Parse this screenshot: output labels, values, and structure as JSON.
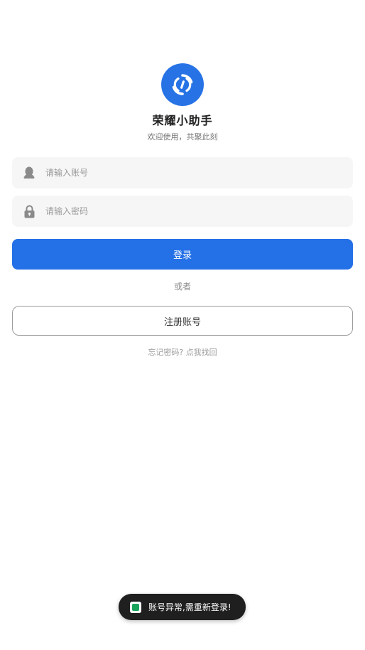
{
  "app": {
    "title": "荣耀小助手",
    "subtitle": "欢迎使用，共聚此刻",
    "logo_icon": "sync-circle-icon",
    "accent_color": "#2470e6"
  },
  "form": {
    "account": {
      "placeholder": "请输入账号",
      "value": "",
      "icon": "user-icon"
    },
    "password": {
      "placeholder": "请输入密码",
      "value": "",
      "icon": "lock-icon"
    },
    "login_label": "登录",
    "or_label": "或者",
    "register_label": "注册账号",
    "forgot_label": "忘记密码? 点我找回"
  },
  "toast": {
    "text": "账号异常,需重新登录!",
    "icon": "app-icon"
  }
}
